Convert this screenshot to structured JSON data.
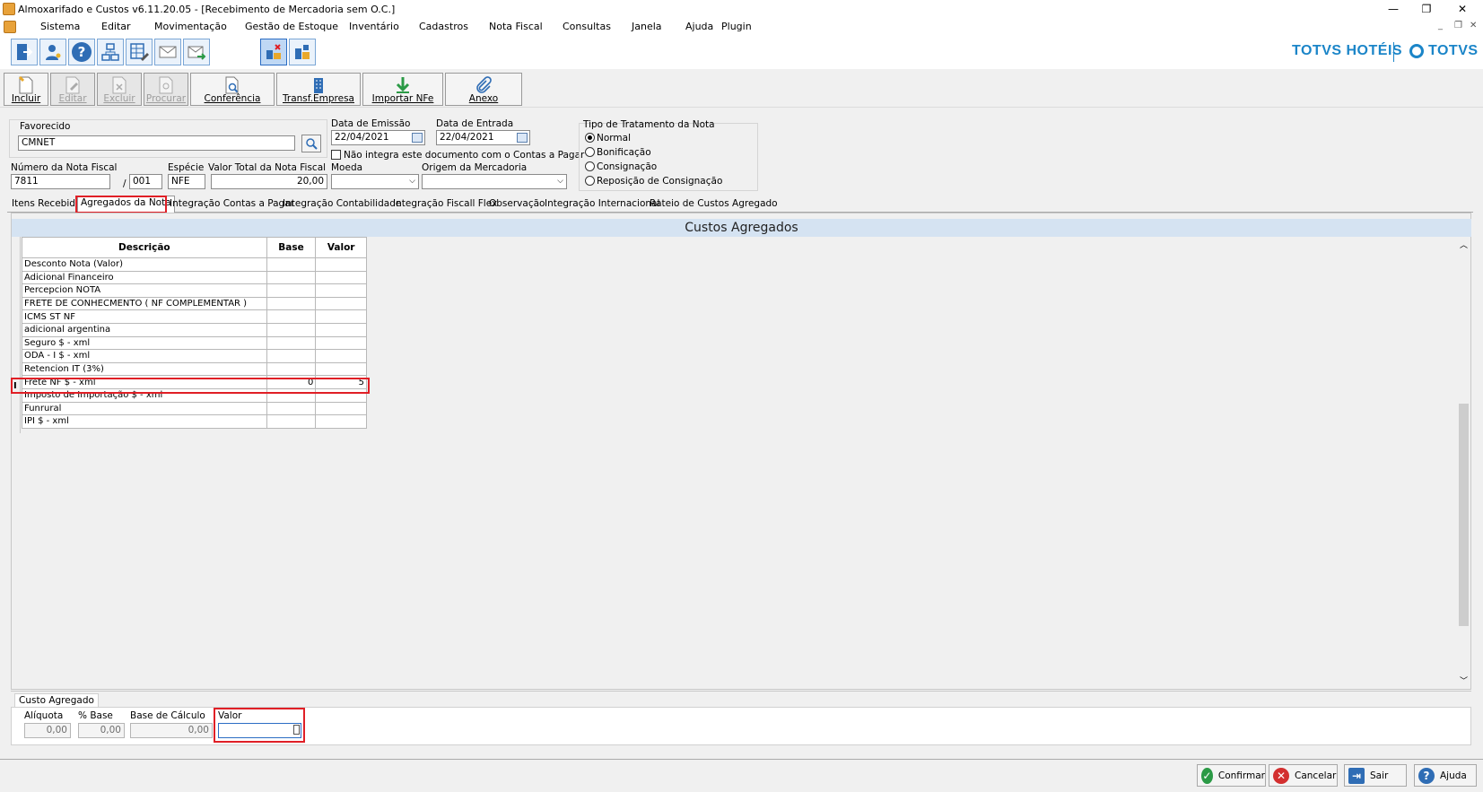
{
  "window": {
    "title": "Almoxarifado e Custos v6.11.20.05 - [Recebimento de Mercadoria sem O.C.]",
    "minimize": "—",
    "restore": "❐",
    "close": "✕"
  },
  "menu": [
    "Sistema",
    "Editar",
    "Movimentação",
    "Gestão de Estoque",
    "Inventário",
    "Cadastros",
    "Nota Fiscal",
    "Consultas",
    "Janela",
    "Ajuda",
    "Plugin"
  ],
  "brand": {
    "left": "TOTVS HOTÉIS",
    "right": "TOTVS"
  },
  "toolbar": {
    "incluir": "Incluir",
    "editar": "Editar",
    "excluir": "Excluir",
    "procurar": "Procurar",
    "conferencia": "Conferência",
    "transf": "Transf.Empresa",
    "importar": "Importar NFe",
    "anexo": "Anexo"
  },
  "form": {
    "favorecido_label": "Favorecido",
    "favorecido_value": "CMNET",
    "data_emissao_label": "Data de Emissão",
    "data_emissao_value": "22/04/2021",
    "data_entrada_label": "Data de Entrada",
    "data_entrada_value": "22/04/2021",
    "nao_integra_label": "Não integra este documento com o Contas a Pagar",
    "numero_label": "Número da Nota Fiscal",
    "numero_value": "7811",
    "separator": "/",
    "serie_value": "001",
    "especie_label": "Espécie",
    "especie_value": "NFE",
    "valor_total_label": "Valor Total da Nota Fiscal",
    "valor_total_value": "20,00",
    "moeda_label": "Moeda",
    "origem_label": "Origem da Mercadoria",
    "tratamento_label": "Tipo de Tratamento da Nota",
    "tratamento_options": [
      "Normal",
      "Bonificação",
      "Consignação",
      "Reposição de Consignação"
    ],
    "tratamento_selected": "Normal"
  },
  "tabs": [
    "Itens Recebidos",
    "Agregados da Nota",
    "Integração Contas a Pagar",
    "Integração Contabilidade",
    "Integração Fiscall Flex",
    "Observação",
    "Integração Internacional",
    "Rateio de Custos Agregado"
  ],
  "active_tab": "Agregados da Nota",
  "grid": {
    "title": "Custos Agregados",
    "headers": {
      "descricao": "Descrição",
      "base": "Base",
      "valor": "Valor"
    },
    "rows": [
      {
        "d": "Desconto Nota (Valor)",
        "b": "",
        "v": ""
      },
      {
        "d": "Adicional Financeiro",
        "b": "",
        "v": ""
      },
      {
        "d": "Percepcion NOTA",
        "b": "",
        "v": ""
      },
      {
        "d": "FRETE DE CONHECMENTO ( NF COMPLEMENTAR )",
        "b": "",
        "v": ""
      },
      {
        "d": "ICMS ST NF",
        "b": "",
        "v": ""
      },
      {
        "d": "adicional argentina",
        "b": "",
        "v": ""
      },
      {
        "d": "Seguro $ - xml",
        "b": "",
        "v": ""
      },
      {
        "d": "ODA - I $ - xml",
        "b": "",
        "v": ""
      },
      {
        "d": "Retencion IT (3%)",
        "b": "",
        "v": ""
      },
      {
        "d": "Frete NF $ - xml",
        "b": "0",
        "v": "5"
      },
      {
        "d": "Imposto de Importação $ - xml",
        "b": "",
        "v": ""
      },
      {
        "d": "Funrural",
        "b": "",
        "v": ""
      },
      {
        "d": "IPI $ - xml",
        "b": "",
        "v": ""
      }
    ],
    "selected_row": "Frete NF $ - xml",
    "row_cursor": "I"
  },
  "custo": {
    "tab_label": "Custo Agregado",
    "aliquota_label": "Alíquota",
    "aliquota_value": "0,00",
    "pbase_label": "% Base",
    "pbase_value": "0,00",
    "base_calc_label": "Base de Cálculo",
    "base_calc_value": "0,00",
    "valor_label": "Valor",
    "valor_value": ""
  },
  "footer": {
    "confirmar": "Confirmar",
    "cancelar": "Cancelar",
    "sair": "Sair",
    "ajuda": "Ajuda"
  },
  "colors": {
    "highlight": "#e01f26",
    "brand": "#1b85c8",
    "grid_title_bg": "#d5e3f2"
  }
}
